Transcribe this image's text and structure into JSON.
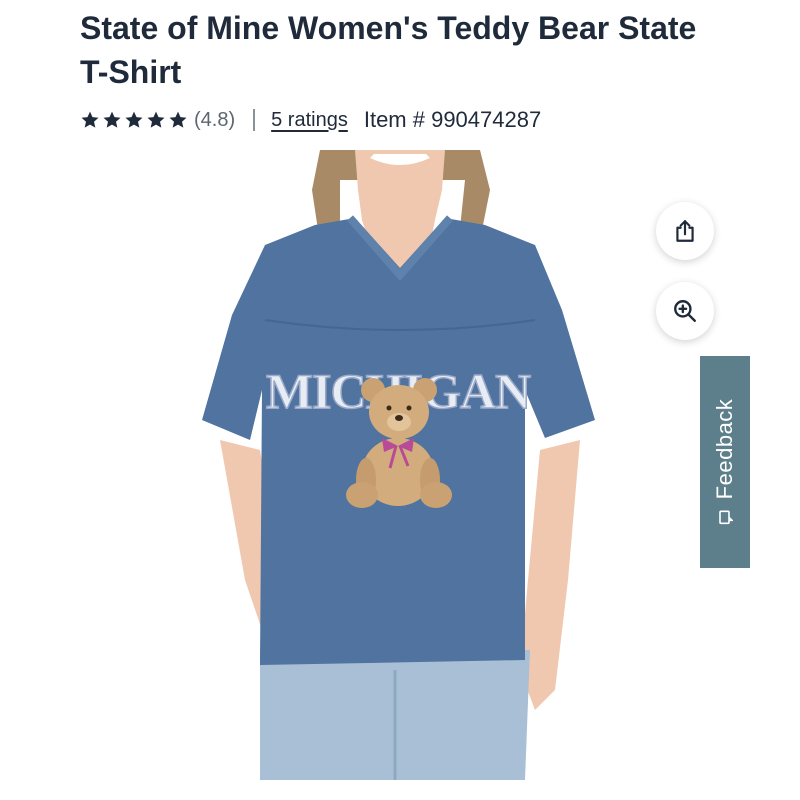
{
  "product": {
    "title": "State of Mine Women's Teddy Bear State T-Shirt",
    "rating_value": "(4.8)",
    "rating_stars": 5,
    "ratings_link": "5 ratings",
    "item_number": "Item # 990474287"
  },
  "image": {
    "shirt_print": "MICHIGAN"
  },
  "actions": {
    "share_icon": "share-icon",
    "zoom_icon": "zoom-in-icon"
  },
  "feedback": {
    "label": "Feedback"
  },
  "colors": {
    "text": "#1f2a3a",
    "feedback_bg": "#5d7f8b",
    "shirt": "#50739f"
  }
}
